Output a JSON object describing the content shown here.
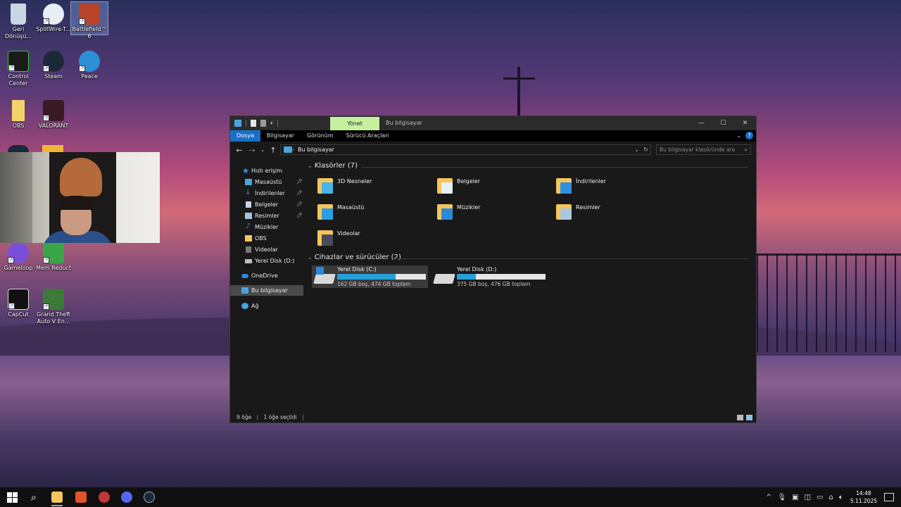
{
  "desktop": {
    "icons": [
      {
        "label": "Geri Dönüşü...",
        "icon": "recycle-bin-icon",
        "color": "#c9d6e4"
      },
      {
        "label": "SplitWire-T...",
        "icon": "splitwire-icon",
        "color": "#e8eef6"
      },
      {
        "label": "Battlefield™ 6",
        "icon": "battlefield-icon",
        "color": "#b8442a"
      },
      {
        "label": "Control Center",
        "icon": "control-center-icon",
        "color": "#1b1b1b"
      },
      {
        "label": "Steam",
        "icon": "steam-icon",
        "color": "#1b2838"
      },
      {
        "label": "Peace",
        "icon": "peace-icon",
        "color": "#2d8fd6"
      },
      {
        "label": "OBS",
        "icon": "obs-icon",
        "color": "#f2d36b"
      },
      {
        "label": "VALORANT",
        "icon": "valorant-icon",
        "color": "#3a1a24"
      },
      {
        "label": "Gameloop",
        "icon": "gameloop-icon",
        "color": "#7a4fd8"
      },
      {
        "label": "Mem Reduct",
        "icon": "mem-reduct-icon",
        "color": "#3aa64a"
      },
      {
        "label": "CapCut",
        "icon": "capcut-icon",
        "color": "#111111"
      },
      {
        "label": "Grand Theft Auto V En...",
        "icon": "gta-icon",
        "color": "#3c7a3a"
      }
    ]
  },
  "explorer": {
    "title": "Bu bilgisayar",
    "manage_tab": "Yönet",
    "window_controls": {
      "minimize": "—",
      "maximize": "☐",
      "close": "✕"
    },
    "ribbon_tabs": [
      "Dosya",
      "Bilgisayar",
      "Görünüm",
      "Sürücü Araçları"
    ],
    "address": "Bu bilgisayar",
    "search_placeholder": "Bu bilgisayar klasöründe ara",
    "nav": [
      {
        "label": "Hızlı erişim",
        "icon": "star-icon",
        "color": "#3d8ee0",
        "pinned": false
      },
      {
        "label": "Masaüstü",
        "icon": "desktop-folder-icon",
        "color": "#4aa3df",
        "pinned": true
      },
      {
        "label": "İndirilenler",
        "icon": "download-icon",
        "color": "#3d8ee0",
        "pinned": true
      },
      {
        "label": "Belgeler",
        "icon": "documents-icon",
        "color": "#c9d6e4",
        "pinned": true
      },
      {
        "label": "Resimler",
        "icon": "pictures-icon",
        "color": "#9fc4e0",
        "pinned": true
      },
      {
        "label": "Müzikler",
        "icon": "music-icon",
        "color": "#3d8ee0",
        "pinned": false
      },
      {
        "label": "OBS",
        "icon": "folder-icon",
        "color": "#f4c55b",
        "pinned": false
      },
      {
        "label": "Videolar",
        "icon": "videos-icon",
        "color": "#7a7a7a",
        "pinned": false
      },
      {
        "label": "Yerel Disk (D:)",
        "icon": "drive-icon",
        "color": "#bdbdbd",
        "pinned": false
      },
      {
        "label": "OneDrive",
        "icon": "onedrive-icon",
        "color": "#2a8ad8",
        "pinned": false
      },
      {
        "label": "Bu bilgisayar",
        "icon": "this-pc-icon",
        "color": "#4aa3df",
        "pinned": false
      },
      {
        "label": "Ağ",
        "icon": "network-icon",
        "color": "#4aa3df",
        "pinned": false
      }
    ],
    "folders_heading": "Klasörler (7)",
    "folders": [
      {
        "label": "3D Nesneler",
        "icon": "3d-objects-folder-icon",
        "accent": "#48b4e8"
      },
      {
        "label": "Belgeler",
        "icon": "documents-folder-icon",
        "accent": "#e8eef4"
      },
      {
        "label": "İndirilenler",
        "icon": "downloads-folder-icon",
        "accent": "#2f8fe0"
      },
      {
        "label": "Masaüstü",
        "icon": "desktop-folder-icon",
        "accent": "#2a9ee0"
      },
      {
        "label": "Müzikler",
        "icon": "music-folder-icon",
        "accent": "#2a8ad8"
      },
      {
        "label": "Resimler",
        "icon": "pictures-folder-icon",
        "accent": "#a9c8e0"
      },
      {
        "label": "Videolar",
        "icon": "videos-folder-icon",
        "accent": "#4a4a5a"
      }
    ],
    "drives_heading": "Cihazlar ve sürücüler (2)",
    "drives": [
      {
        "name": "Yerel Disk (C:)",
        "info": "162 GB boş, 474 GB toplam",
        "used_fraction": 0.658,
        "system": true
      },
      {
        "name": "Yerel Disk (D:)",
        "info": "375 GB boş, 476 GB toplam",
        "used_fraction": 0.212,
        "system": false
      }
    ],
    "status": {
      "items": "9 öğe",
      "selected": "1 öğe seçildi"
    }
  },
  "taskbar": {
    "apps": [
      {
        "icon": "start-icon"
      },
      {
        "icon": "search-icon"
      },
      {
        "icon": "file-explorer-icon",
        "color": "#f4c55b"
      },
      {
        "icon": "brave-icon",
        "color": "#e2522b"
      },
      {
        "icon": "app-icon",
        "color": "#c0383a"
      },
      {
        "icon": "discord-icon",
        "color": "#5865f2"
      },
      {
        "icon": "steam-icon",
        "color": "#1b2838"
      }
    ],
    "time": "14:48",
    "date": "5.11.2025"
  }
}
